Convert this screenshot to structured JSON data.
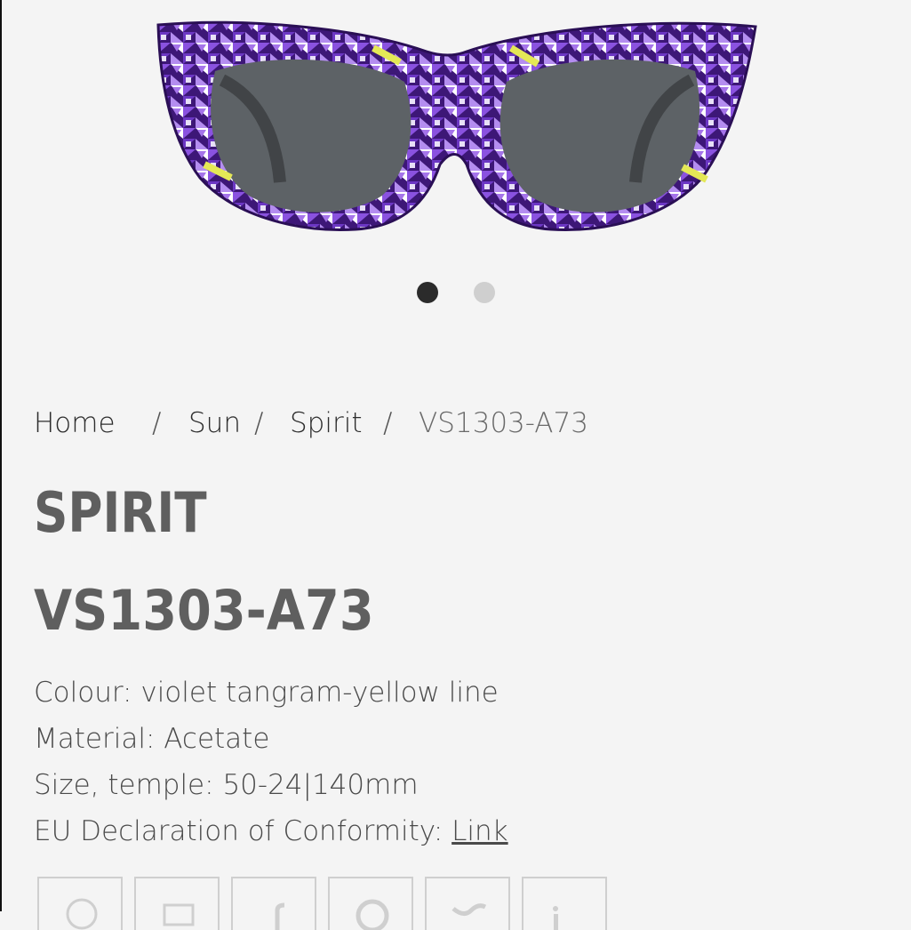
{
  "carousel": {
    "image_alt": "violet tangram sunglasses",
    "slides": 2,
    "active_index": 0
  },
  "breadcrumb": {
    "items": [
      "Home",
      "Sun",
      "Spirit"
    ],
    "separator": "/",
    "current": "VS1303-A73"
  },
  "product": {
    "collection": "SPIRIT",
    "model": "VS1303-A73",
    "colour_label": "Colour:",
    "colour_value": "violet tangram-yellow line",
    "material_label": "Material:",
    "material_value": "Acetate",
    "size_label": "Size, temple:",
    "size_value": "50-24|140mm",
    "conformity_label": "EU Declaration of Conformity:",
    "conformity_link": "Link"
  },
  "share": {
    "icons": [
      "whatsapp-icon",
      "email-icon",
      "facebook-icon",
      "pinterest-icon",
      "twitter-icon",
      "linkedin-icon"
    ]
  },
  "colors": {
    "frame": "#5b2a9e",
    "accent": "#e4e856",
    "lens": "#5d6266",
    "background": "#f4f4f4"
  }
}
